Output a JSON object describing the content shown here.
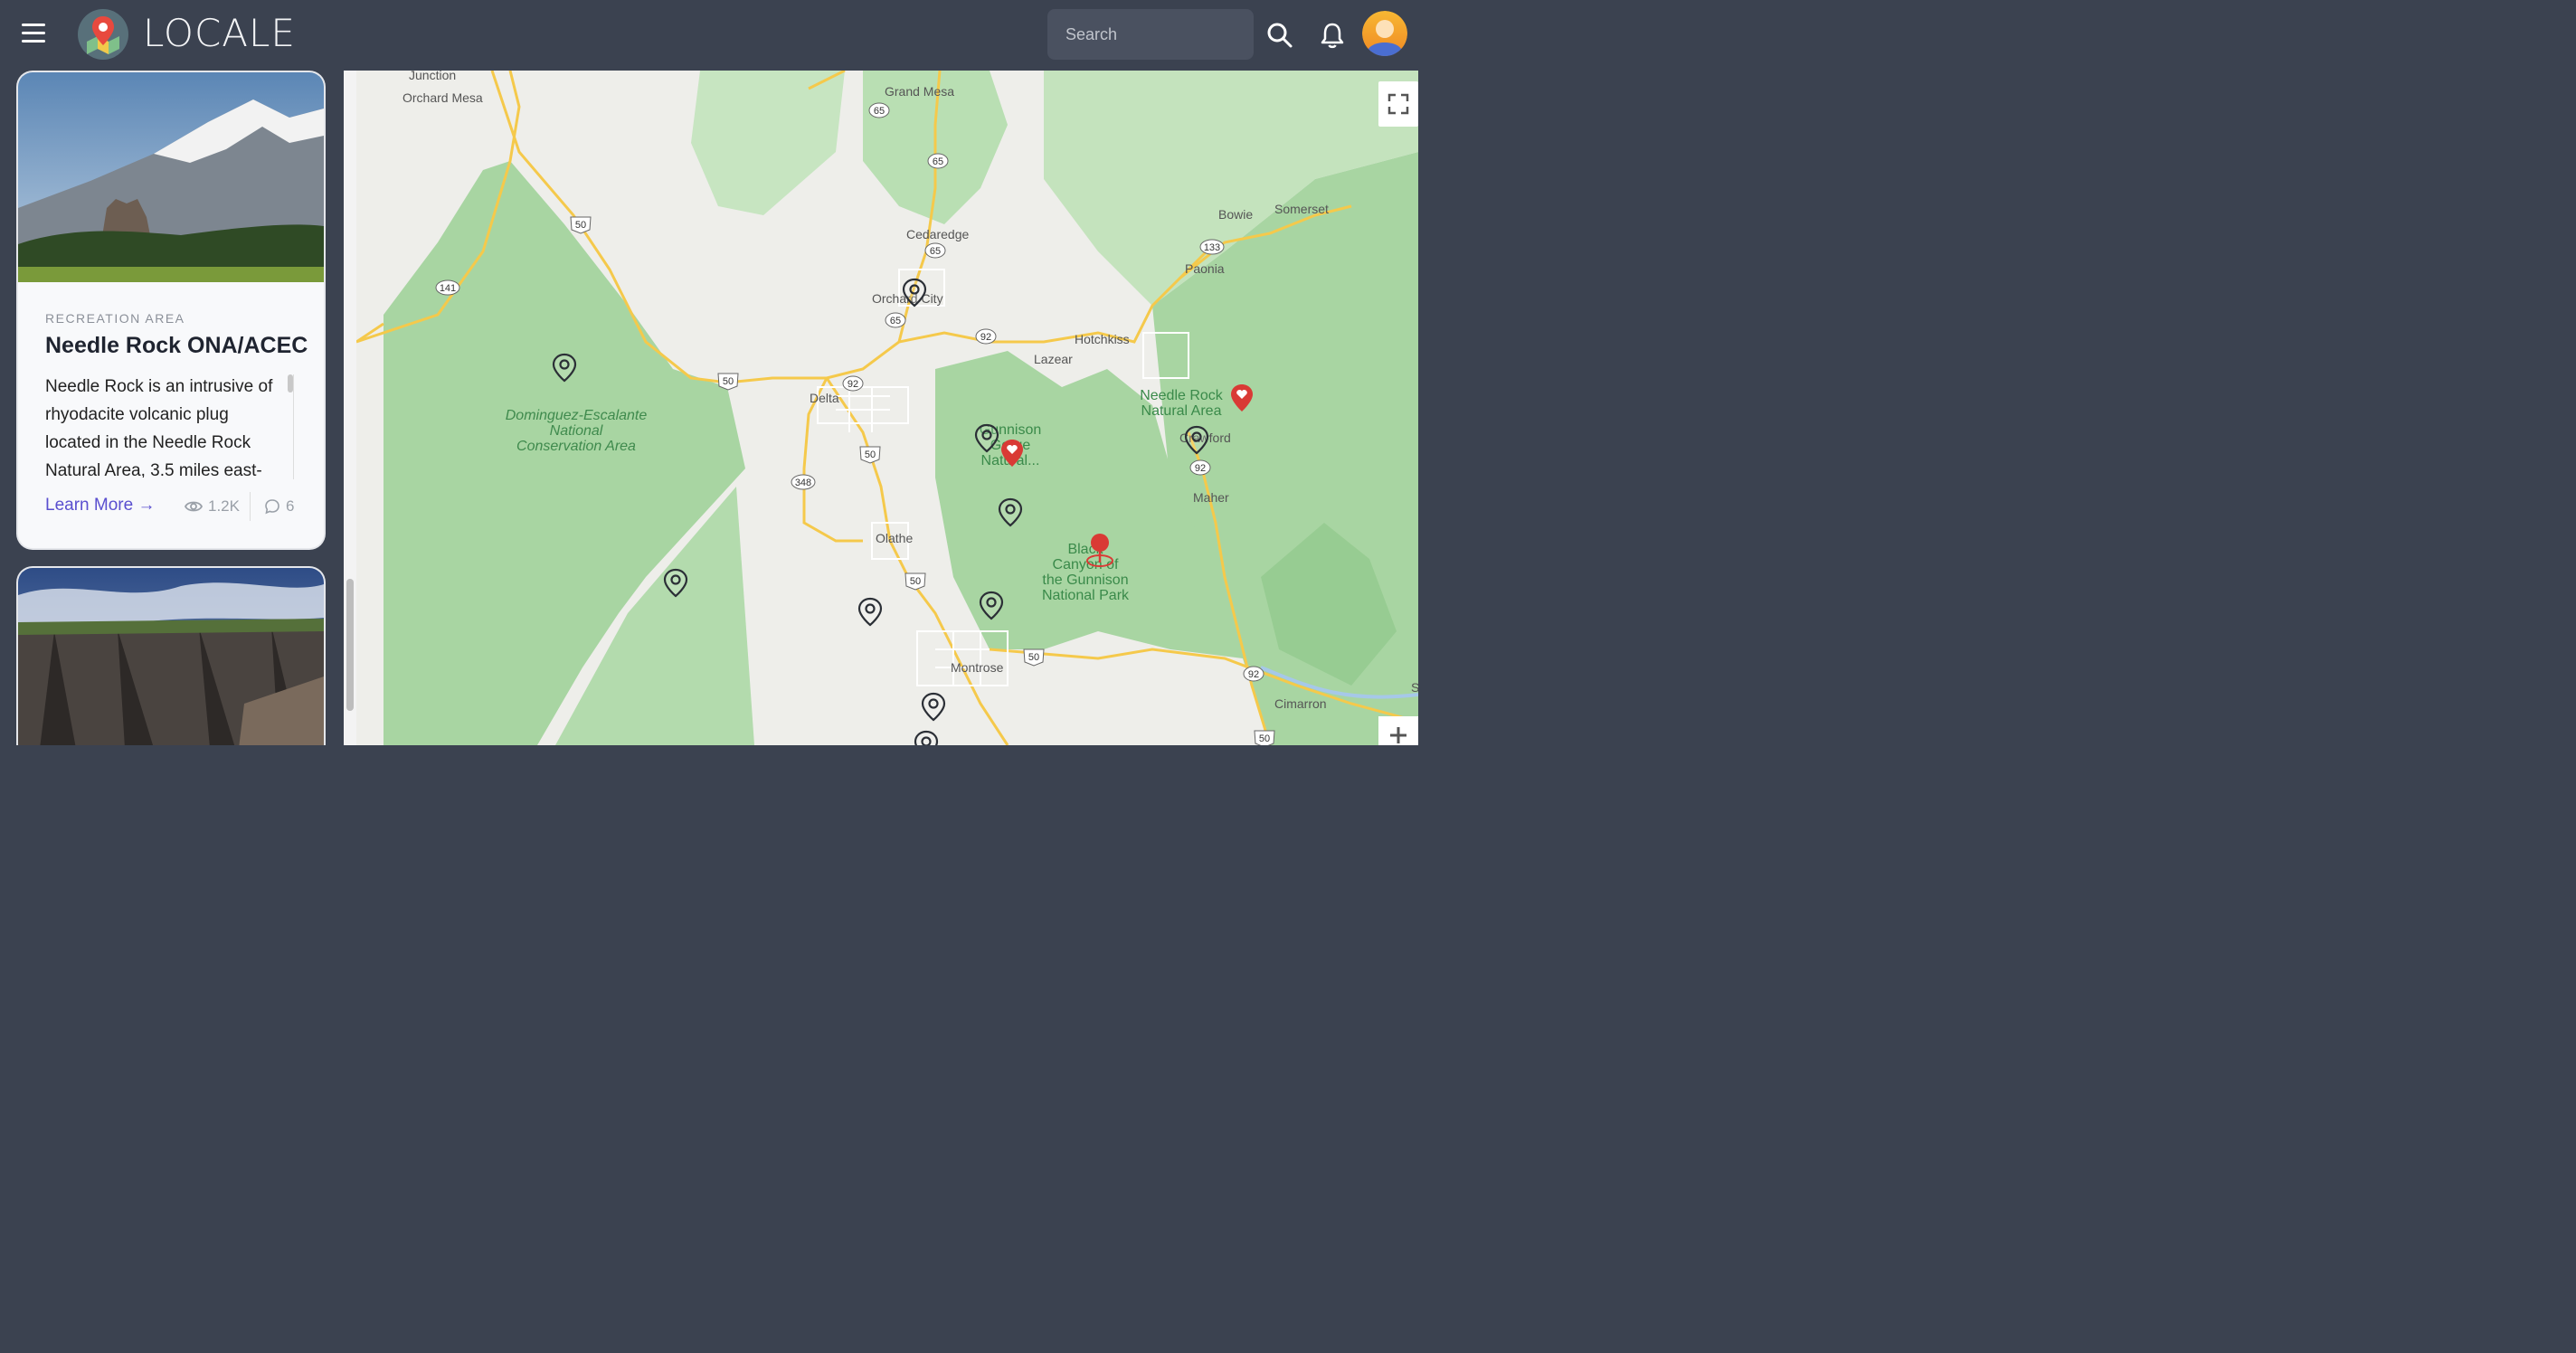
{
  "header": {
    "brand": "LOCALE",
    "search_placeholder": "Search",
    "icons": [
      "menu-icon",
      "logo-map-icon",
      "search-icon",
      "bell-icon",
      "avatar"
    ]
  },
  "cards": [
    {
      "category": "RECREATION AREA",
      "title": "Needle Rock ONA/ACEC",
      "description": "Needle Rock is an intrusive of rhyodacite volcanic plug located in the Needle Rock Natural Area, 3.5 miles east-",
      "learn_more": "Learn More",
      "views": "1.2K",
      "comments": "6"
    },
    {
      "category": "",
      "title": ""
    }
  ],
  "map": {
    "places": {
      "junction": "Junction",
      "orchard_mesa": "Orchard Mesa",
      "grand_mesa": "Grand Mesa",
      "cedaredge": "Cedaredge",
      "orchard_city": "Orchard City",
      "delta": "Delta",
      "lazear": "Lazear",
      "hotchkiss": "Hotchkiss",
      "paonia": "Paonia",
      "bowie": "Bowie",
      "somerset": "Somerset",
      "crawford": "Crawford",
      "maher": "Maher",
      "olathe": "Olathe",
      "montrose": "Montrose",
      "cimarron": "Cimarron",
      "dominguez_1": "Dominguez-Escalante",
      "dominguez_2": "National",
      "dominguez_3": "Conservation Area",
      "gunnison_gorge_1": "Gunnison",
      "gunnison_gorge_2": "Gorge",
      "gunnison_gorge_3": "Natural...",
      "needle_rock_1": "Needle Rock",
      "needle_rock_2": "Natural Area",
      "black_canyon_1": "Black",
      "black_canyon_2": "Canyon of",
      "black_canyon_3": "the Gunnison",
      "black_canyon_4": "National Park",
      "s_edge": "S"
    },
    "routes": {
      "r65a": "65",
      "r65b": "65",
      "r65c": "65",
      "r65d": "65",
      "r50a": "50",
      "r50b": "50",
      "r50c": "50",
      "r50d": "50",
      "r50e": "50",
      "r50f": "50",
      "r141": "141",
      "r92a": "92",
      "r92b": "92",
      "r92c": "92",
      "r92d": "92",
      "r133": "133",
      "r348": "348"
    },
    "colors": {
      "land": "#eeeeea",
      "forest": "#a8d5a2",
      "forest_dark": "#97cc92",
      "road": "#f5c94b",
      "marker_red": "#d93a35",
      "marker_outline": "#2b2f36"
    }
  }
}
